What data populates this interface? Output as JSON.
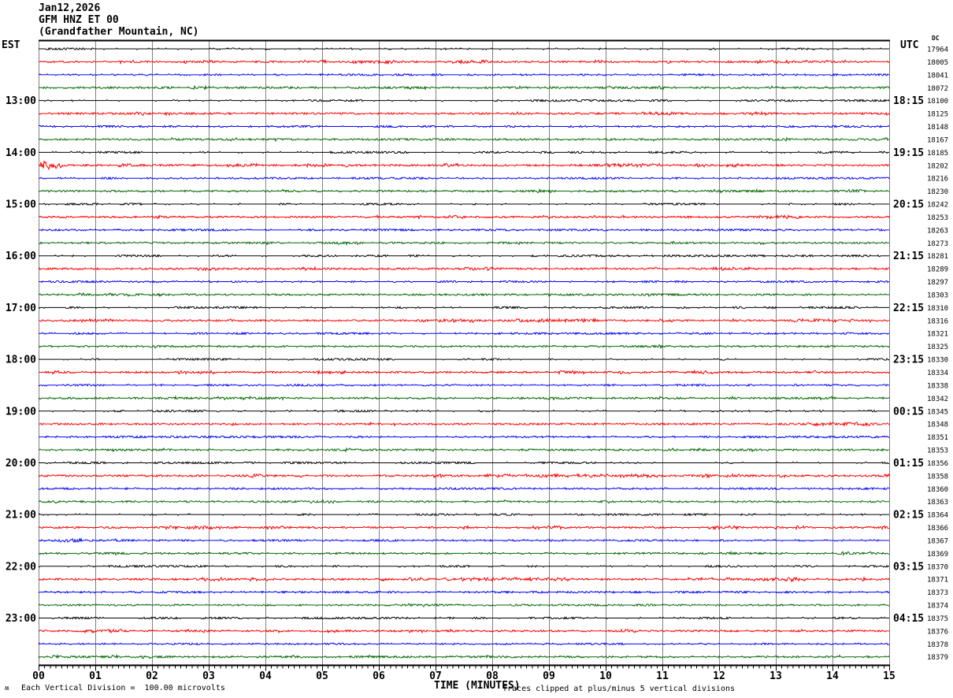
{
  "header": {
    "date": "Jan12,2026",
    "station": "GFM HNZ ET 00",
    "location": "(Grandfather Mountain, NC)"
  },
  "colors": {
    "black": "#000000",
    "red": "#fe0000",
    "blue": "#0000fe",
    "green": "#006600",
    "grid": "#808080",
    "background": "#ffffff"
  },
  "chart_data": {
    "type": "line",
    "title": "GFM HNZ ET 00 (Grandfather Mountain, NC) helicorder Jan12,2026",
    "xlabel": "TIME (MINUTES)",
    "x_tick_labels": [
      "00",
      "01",
      "02",
      "03",
      "04",
      "05",
      "06",
      "07",
      "08",
      "09",
      "10",
      "11",
      "12",
      "13",
      "14",
      "15"
    ],
    "x_range_minutes": [
      0,
      15
    ],
    "minutes_per_row": 15,
    "num_rows": 48,
    "row_color_cycle": [
      "black",
      "red",
      "blue",
      "green"
    ],
    "left_header": "EST",
    "right_header": "UTC",
    "dc_header": "DC",
    "est_hour_labels": [
      "13:00",
      "14:00",
      "15:00",
      "16:00",
      "17:00",
      "18:00",
      "19:00",
      "20:00",
      "21:00",
      "22:00",
      "23:00"
    ],
    "utc_hour_labels": [
      "18:15",
      "19:15",
      "20:15",
      "21:15",
      "22:15",
      "23:15",
      "00:15",
      "01:15",
      "02:15",
      "03:15",
      "04:15"
    ],
    "dc_values": [
      17964,
      18005,
      18041,
      18072,
      18100,
      18125,
      18148,
      18167,
      18185,
      18202,
      18216,
      18230,
      18242,
      18253,
      18263,
      18273,
      18281,
      18289,
      18297,
      18303,
      18310,
      18316,
      18321,
      18325,
      18330,
      18334,
      18338,
      18342,
      18345,
      18348,
      18351,
      18353,
      18356,
      18358,
      18360,
      18363,
      18364,
      18366,
      18367,
      18369,
      18370,
      18371,
      18373,
      18374,
      18375,
      18376,
      18378,
      18379
    ],
    "scale_note": "Each Vertical Division =  100.00 microvolts",
    "clip_note": "Traces clipped at plus/minus 5 vertical divisions",
    "watermark": "ʍ",
    "waveform": "background seismic noise, traces flat with intermittent denser noise patches",
    "events": [
      {
        "trace": 9,
        "minute": 0.1,
        "sigma": 0.25,
        "amp": 4.5
      },
      {
        "trace": 37,
        "minute": 2.35,
        "sigma": 0.15,
        "amp": 1.6
      },
      {
        "trace": 38,
        "minute": 0.6,
        "sigma": 0.35,
        "amp": 1.4
      },
      {
        "trace": 41,
        "minute": 13.3,
        "sigma": 0.06,
        "amp": 2.6
      }
    ]
  }
}
